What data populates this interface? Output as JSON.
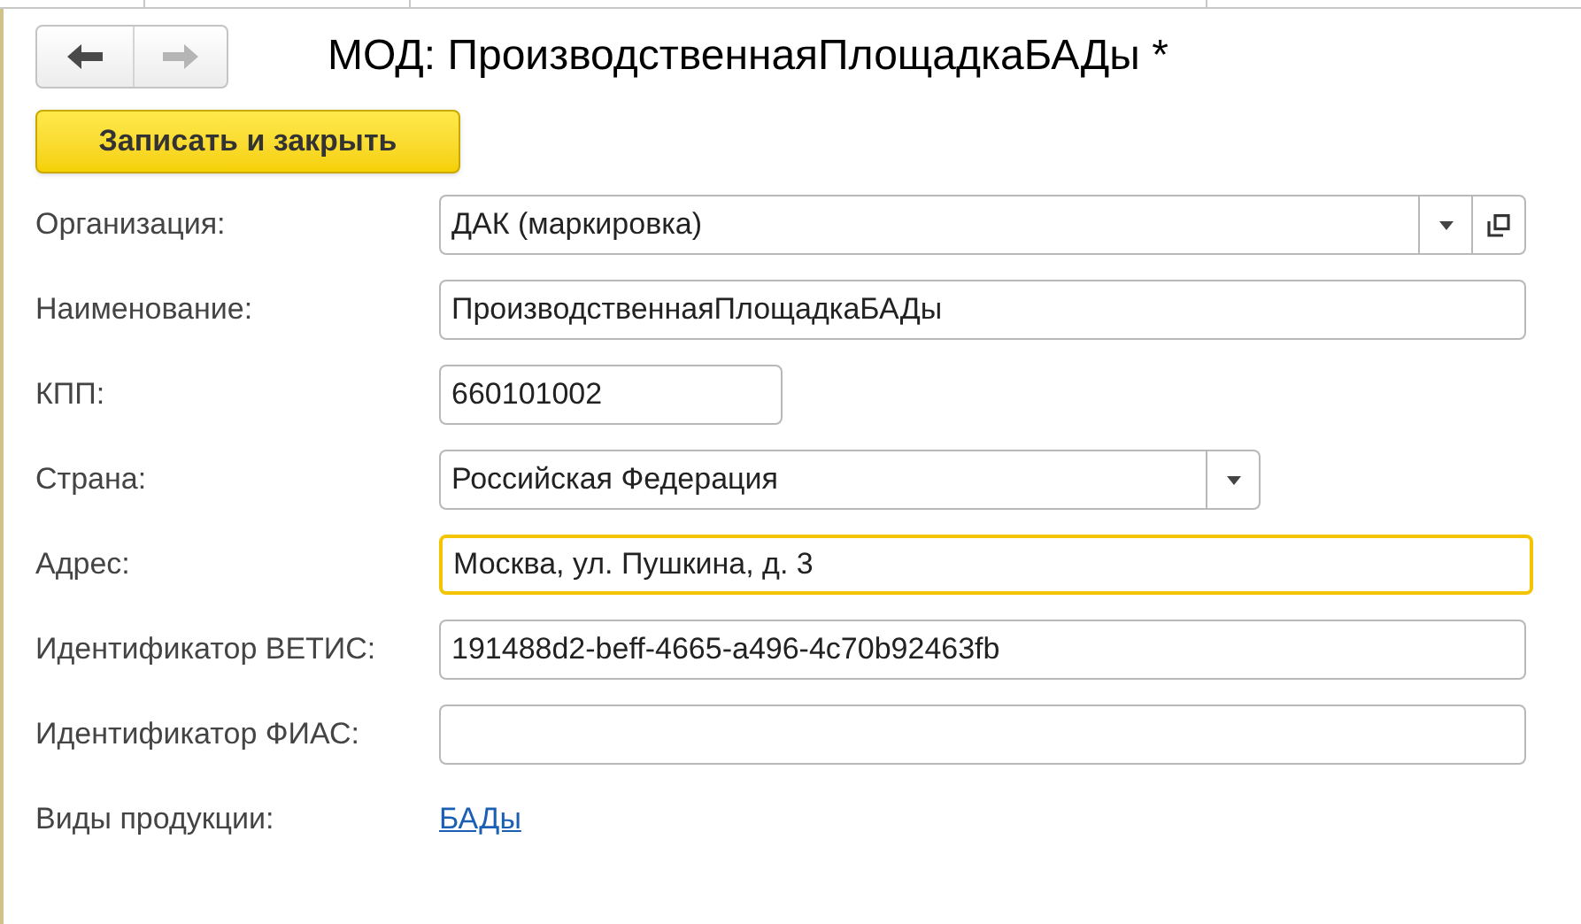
{
  "nav": {
    "back_disabled": false,
    "forward_disabled": true
  },
  "title": "МОД: ПроизводственнаяПлощадкаБАДы *",
  "save_button": "Записать и закрыть",
  "fields": [
    {
      "label": "Организация:",
      "kind": "select",
      "value": "ДАК (маркировка)",
      "focused": false,
      "open_button": true
    },
    {
      "label": "Наименование:",
      "kind": "text",
      "value": "ПроизводственнаяПлощадкаБАДы",
      "focused": false
    },
    {
      "label": "КПП:",
      "kind": "text",
      "value": "660101002",
      "focused": false
    },
    {
      "label": "Страна:",
      "kind": "select",
      "value": "Российская Федерация",
      "focused": false,
      "open_button": false
    },
    {
      "label": "Адрес:",
      "kind": "text",
      "value": "Москва, ул. Пушкина, д. 3",
      "focused": true
    },
    {
      "label": "Идентификатор ВЕТИС:",
      "kind": "text",
      "value": "191488d2-beff-4665-a496-4c70b92463fb",
      "focused": false
    },
    {
      "label": "Идентификатор ФИАС:",
      "kind": "text",
      "focused": false
    },
    {
      "label": "Виды продукции:",
      "kind": "link",
      "value": "БАДы"
    }
  ]
}
